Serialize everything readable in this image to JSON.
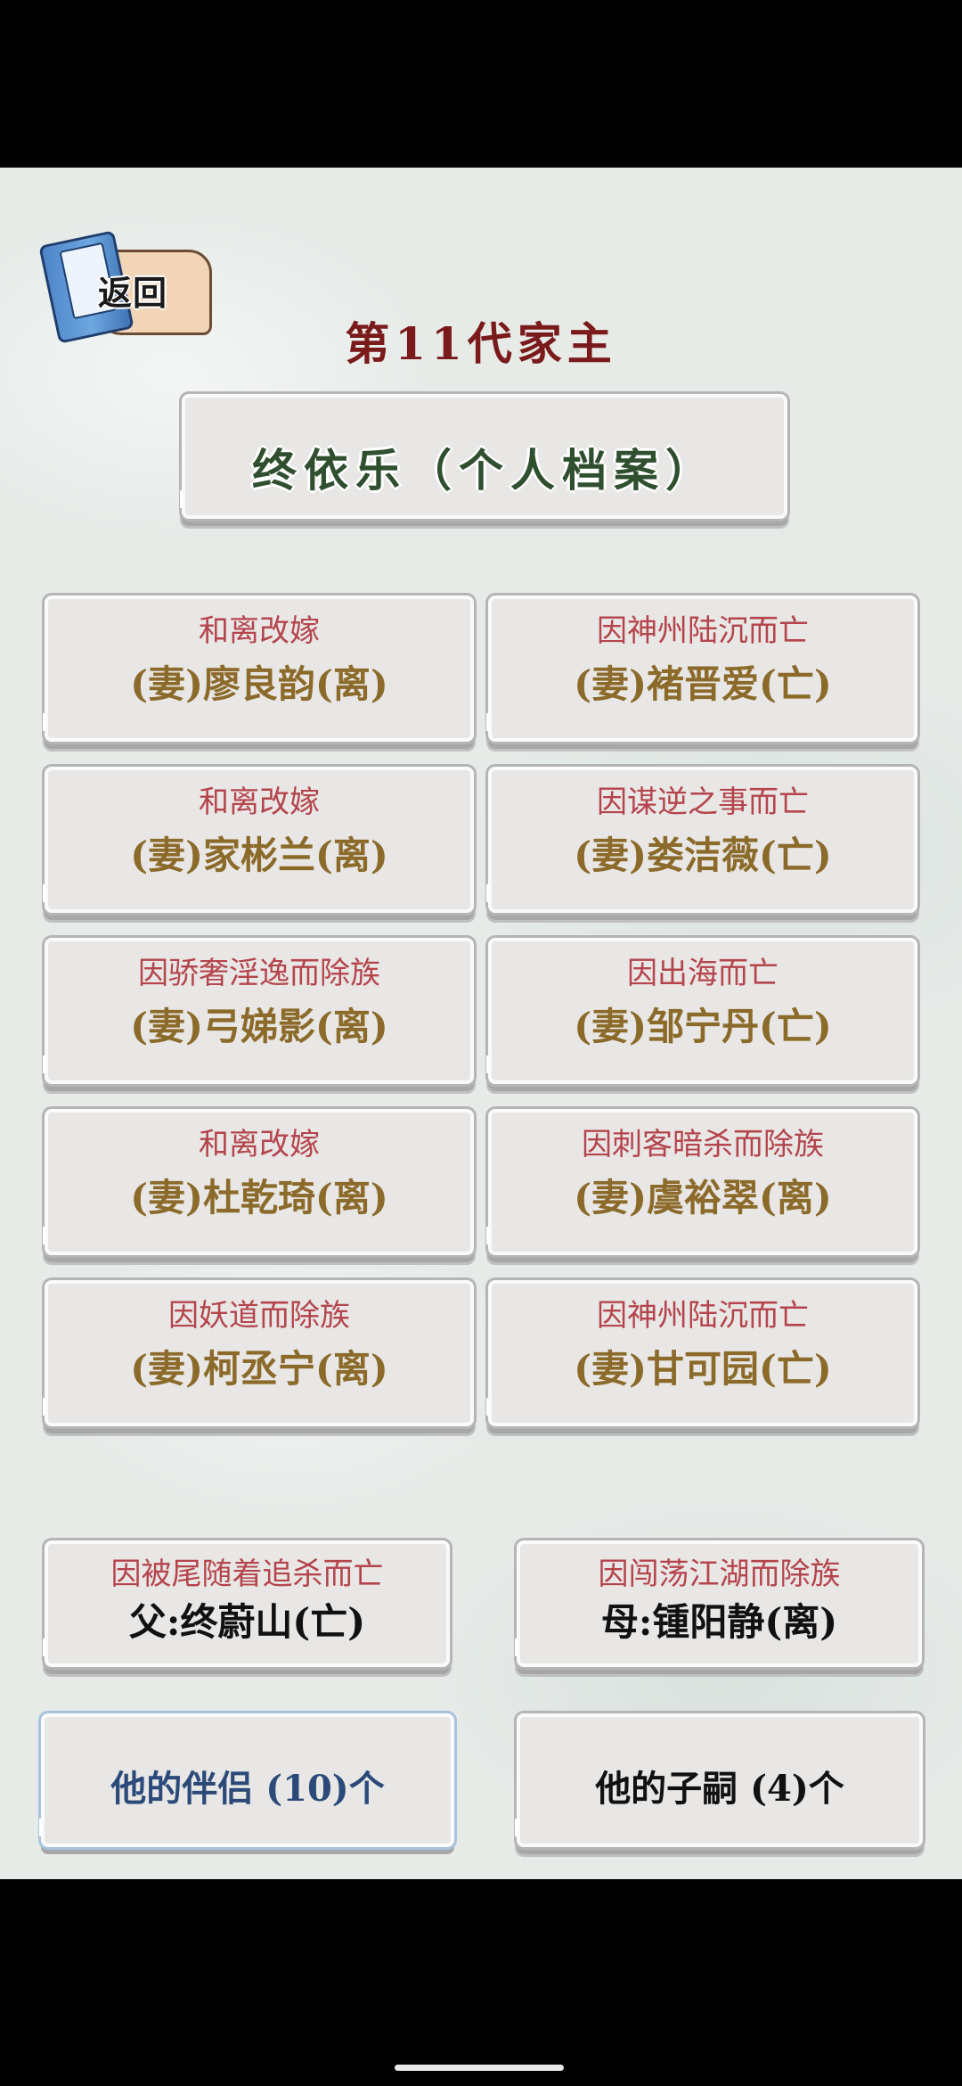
{
  "header": {
    "back_label": "返回",
    "title": "第11代家主"
  },
  "profile": {
    "name_label": "终依乐（个人档案）"
  },
  "partners": [
    {
      "note": "和离改嫁",
      "who": "(妻)廖良韵(离)"
    },
    {
      "note": "因神州陆沉而亡",
      "who": "(妻)褚晋爱(亡)"
    },
    {
      "note": "和离改嫁",
      "who": "(妻)家彬兰(离)"
    },
    {
      "note": "因谋逆之事而亡",
      "who": "(妻)娄洁薇(亡)"
    },
    {
      "note": "因骄奢淫逸而除族",
      "who": "(妻)弓娣影(离)"
    },
    {
      "note": "因出海而亡",
      "who": "(妻)邹宁丹(亡)"
    },
    {
      "note": "和离改嫁",
      "who": "(妻)杜乾琦(离)"
    },
    {
      "note": "因刺客暗杀而除族",
      "who": "(妻)虞裕翠(离)"
    },
    {
      "note": "因妖道而除族",
      "who": "(妻)柯丞宁(离)"
    },
    {
      "note": "因神州陆沉而亡",
      "who": "(妻)甘可园(亡)"
    }
  ],
  "parents": {
    "father": {
      "note": "因被尾随着追杀而亡",
      "who": "父:终蔚山(亡)"
    },
    "mother": {
      "note": "因闯荡江湖而除族",
      "who": "母:锺阳静(离)"
    }
  },
  "tabs": {
    "partners_label": "他的伴侣 (10)个",
    "children_label": "他的子嗣 (4)个"
  },
  "colors": {
    "title": "#7a1a1a",
    "name": "#2f4f2f",
    "note": "#b5444c",
    "partner_name": "#8b6a2a",
    "active_tab": "#2b4a7a"
  }
}
